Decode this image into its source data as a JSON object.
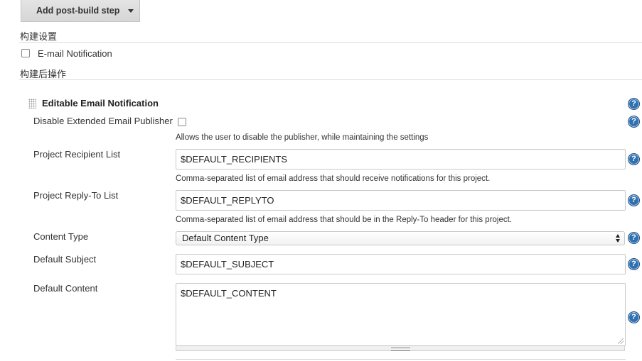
{
  "toolbar": {
    "add_post_build_label": "Add post-build step"
  },
  "sections": {
    "build_settings": "构建设置",
    "post_build_actions": "构建后操作"
  },
  "build_settings": {
    "email_notification_label": "E-mail Notification",
    "email_notification_checked": false
  },
  "editable_email": {
    "title": "Editable Email Notification",
    "disable_label": "Disable Extended Email Publisher",
    "disable_checked": false,
    "disable_help": "Allows the user to disable the publisher, while maintaining the settings",
    "recipient_label": "Project Recipient List",
    "recipient_value": "$DEFAULT_RECIPIENTS",
    "recipient_help": "Comma-separated list of email address that should receive notifications for this project.",
    "replyto_label": "Project Reply-To List",
    "replyto_value": "$DEFAULT_REPLYTO",
    "replyto_help": "Comma-separated list of email address that should be in the Reply-To header for this project.",
    "content_type_label": "Content Type",
    "content_type_value": "Default Content Type",
    "subject_label": "Default Subject",
    "subject_value": "$DEFAULT_SUBJECT",
    "content_label": "Default Content",
    "content_value": "$DEFAULT_CONTENT"
  },
  "help_icon_glyph": "?",
  "icons": {
    "help": "question-circle-icon",
    "drag": "drag-handle-icon",
    "caret": "caret-down-icon"
  },
  "colors": {
    "help_icon": "#2f71b0",
    "divider": "#dcdcdc",
    "button_bg": "#dcdcdc"
  }
}
